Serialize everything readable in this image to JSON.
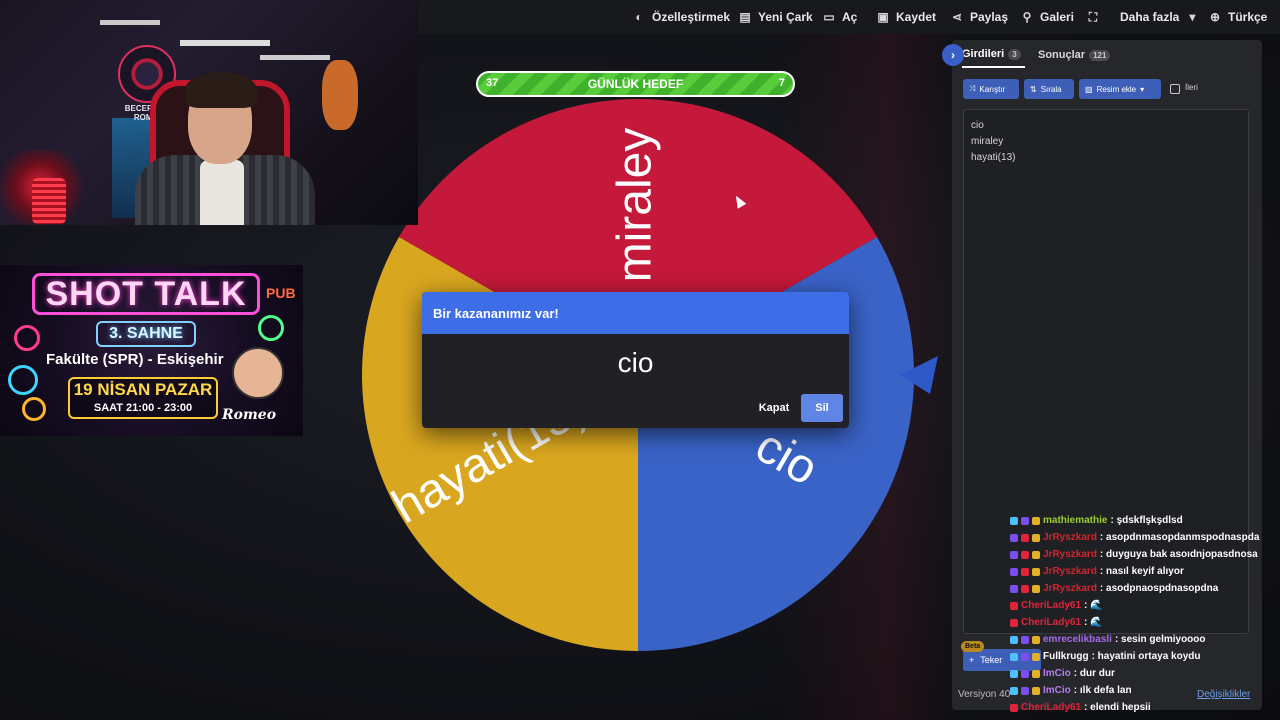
{
  "nav": {
    "items": [
      {
        "label": "Özelleştirmek",
        "icon": "palette-icon",
        "glyph": "◐"
      },
      {
        "label": "Yeni Çark",
        "icon": "file-icon",
        "glyph": "▤"
      },
      {
        "label": "Aç",
        "icon": "folder-open-icon",
        "glyph": "▭"
      },
      {
        "label": "Kaydet",
        "icon": "save-icon",
        "glyph": "▣"
      },
      {
        "label": "Paylaş",
        "icon": "share-icon",
        "glyph": "⋖"
      },
      {
        "label": "Galeri",
        "icon": "search-icon",
        "glyph": "⚲"
      },
      {
        "label": "",
        "icon": "fullscreen-icon",
        "glyph": "⛶"
      },
      {
        "label": "Daha fazla",
        "icon": "caret-down-icon",
        "glyph": "▾"
      },
      {
        "label": "Türkçe",
        "icon": "globe-icon",
        "glyph": "⊕"
      }
    ]
  },
  "webcam": {
    "logo_text": "BECERIKSIZ ROMEO"
  },
  "poster": {
    "title": "SHOT TALK",
    "stage": "3. SAHNE",
    "location": "Fakülte (SPR) - Eskişehir",
    "date": "19 NİSAN PAZAR",
    "time": "SAAT 21:00 - 23:00",
    "pub": "PUB",
    "signature": "Romeo"
  },
  "goal": {
    "left_value": "37",
    "title": "GÜNLÜK HEDEF",
    "right_value": "7",
    "fill_fraction": 1.0
  },
  "wheel": {
    "segments": [
      {
        "label": "miraley",
        "color": "#c4193a"
      },
      {
        "label": "cio",
        "color": "#3a63c7"
      },
      {
        "label": "hayati(13)",
        "color": "#d9a61f"
      }
    ]
  },
  "dialog": {
    "title": "Bir kazananımız var!",
    "winner": "cio",
    "close_label": "Kapat",
    "remove_label": "Sil"
  },
  "panel": {
    "tab_entries": "Girdileri",
    "tab_entries_count": "3",
    "tab_results": "Sonuçlar",
    "tab_results_count": "121",
    "shuffle_label": "Karıştır",
    "sort_label": "Sırala",
    "add_image_label": "Resim ekle",
    "advanced_label": "İleri",
    "entries": [
      "cio",
      "miraley",
      "hayati(13)"
    ],
    "beta": "Beta",
    "wheels_label": "Teker",
    "version": "Versiyon 40",
    "changes": "Değişiklikler"
  },
  "chat": [
    {
      "user": "mathiemathie",
      "color": "#9acd32",
      "msg": ": şdskflşkşdlsd"
    },
    {
      "user": "JrRyszkard",
      "color": "#d0262f",
      "msg": ": asopdnmasopdanmspodnaspda"
    },
    {
      "user": "JrRyszkard",
      "color": "#d0262f",
      "msg": ": duyguya bak asoıdnjopasdnosa"
    },
    {
      "user": "JrRyszkard",
      "color": "#d0262f",
      "msg": ": nasıl keyif alıyor"
    },
    {
      "user": "JrRyszkard",
      "color": "#d0262f",
      "msg": ": asodpnaospdnasopdna"
    },
    {
      "user": "CheriLady61",
      "color": "#e0243a",
      "msg": ": 🌊"
    },
    {
      "user": "CheriLady61",
      "color": "#e0243a",
      "msg": ": 🌊"
    },
    {
      "user": "emrecelikbasli",
      "color": "#a66be8",
      "msg": ": sesin gelmiyoooo"
    },
    {
      "user": "Fullkrugg",
      "color": "#ffffff",
      "msg": ": hayatini ortaya koydu"
    },
    {
      "user": "ImCio",
      "color": "#b77cf0",
      "msg": ": dur dur"
    },
    {
      "user": "ImCio",
      "color": "#b77cf0",
      "msg": ": ılk defa lan"
    },
    {
      "user": "CheriLady61",
      "color": "#e0243a",
      "msg": ": elendi hepsii"
    }
  ]
}
